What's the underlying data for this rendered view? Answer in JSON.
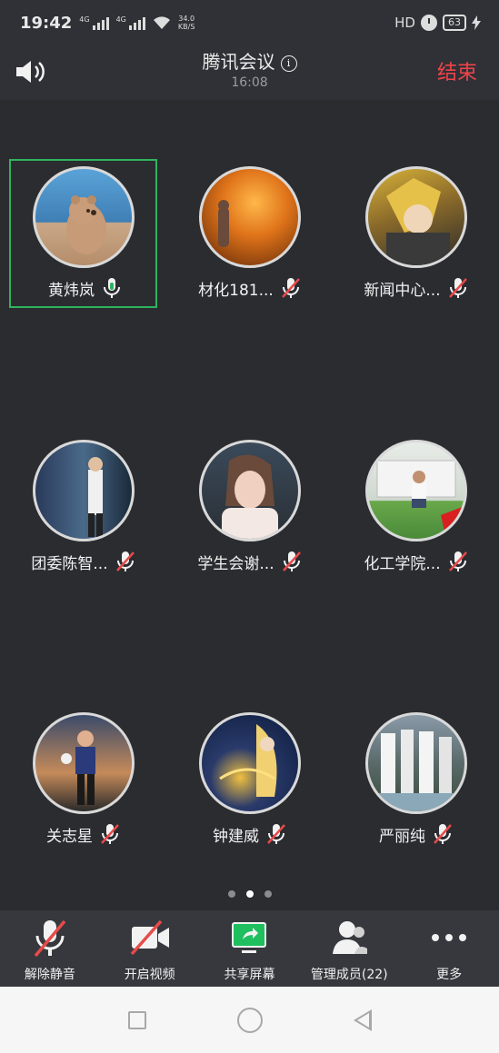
{
  "status_bar": {
    "time": "19:42",
    "signal1_tag": "4G",
    "signal2_tag": "4G",
    "net_speed_value": "34.0",
    "net_speed_unit": "KB/S",
    "hd_label": "HD",
    "battery": "63"
  },
  "header": {
    "title": "腾讯会议",
    "info_icon": "i",
    "duration": "16:08",
    "end_label": "结束"
  },
  "participants": [
    {
      "name": "黄炜岚",
      "mic": "mic-on"
    },
    {
      "name": "材化181...",
      "mic": "mic-off"
    },
    {
      "name": "新闻中心...",
      "mic": "mic-off"
    },
    {
      "name": "团委陈智...",
      "mic": "mic-off"
    },
    {
      "name": "学生会谢...",
      "mic": "mic-off"
    },
    {
      "name": "化工学院...",
      "mic": "mic-off"
    },
    {
      "name": "关志星",
      "mic": "mic-off"
    },
    {
      "name": "钟建威",
      "mic": "mic-off"
    },
    {
      "name": "严丽纯",
      "mic": "mic-off"
    }
  ],
  "pager": {
    "pages": 3,
    "current": 2
  },
  "toolbar": {
    "unmute_label": "解除静音",
    "video_label": "开启视频",
    "share_label": "共享屏幕",
    "members_label": "管理成员(22)",
    "more_label": "更多"
  },
  "colors": {
    "end_red": "#f0444a",
    "active_green": "#2fb35e",
    "mute_red": "#e84a4a",
    "share_green": "#1fbf5f"
  }
}
